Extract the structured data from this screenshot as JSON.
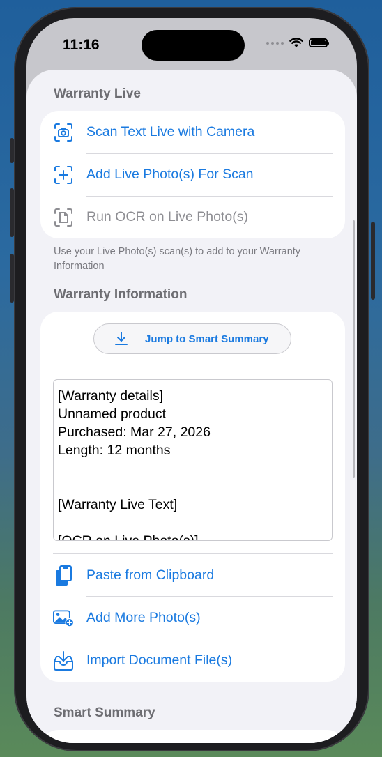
{
  "status": {
    "time": "11:16"
  },
  "warranty_live": {
    "header": "Warranty Live",
    "items": [
      {
        "label": "Scan Text Live with Camera",
        "icon": "camera-scan-icon",
        "enabled": true
      },
      {
        "label": "Add Live Photo(s) For Scan",
        "icon": "add-scan-icon",
        "enabled": true
      },
      {
        "label": "Run OCR on Live Photo(s)",
        "icon": "document-scan-icon",
        "enabled": false
      }
    ],
    "footer": "Use your Live Photo(s) scan(s) to add to your Warranty Information"
  },
  "warranty_info": {
    "header": "Warranty Information",
    "jump_button": "Jump to Smart Summary",
    "text_content": "[Warranty details]\nUnnamed product\nPurchased: Mar 27, 2026\nLength: 12 months\n\n\n[Warranty Live Text]\n\n[OCR on Live Photo(s)]",
    "actions": [
      {
        "label": "Paste from Clipboard",
        "icon": "clipboard-icon"
      },
      {
        "label": "Add More Photo(s)",
        "icon": "add-photo-icon"
      },
      {
        "label": "Import Document File(s)",
        "icon": "import-tray-icon"
      }
    ]
  },
  "smart_summary": {
    "header": "Smart Summary"
  },
  "colors": {
    "accent": "#1a7ae0",
    "disabled": "#8e8e93",
    "background": "#f2f2f7"
  }
}
